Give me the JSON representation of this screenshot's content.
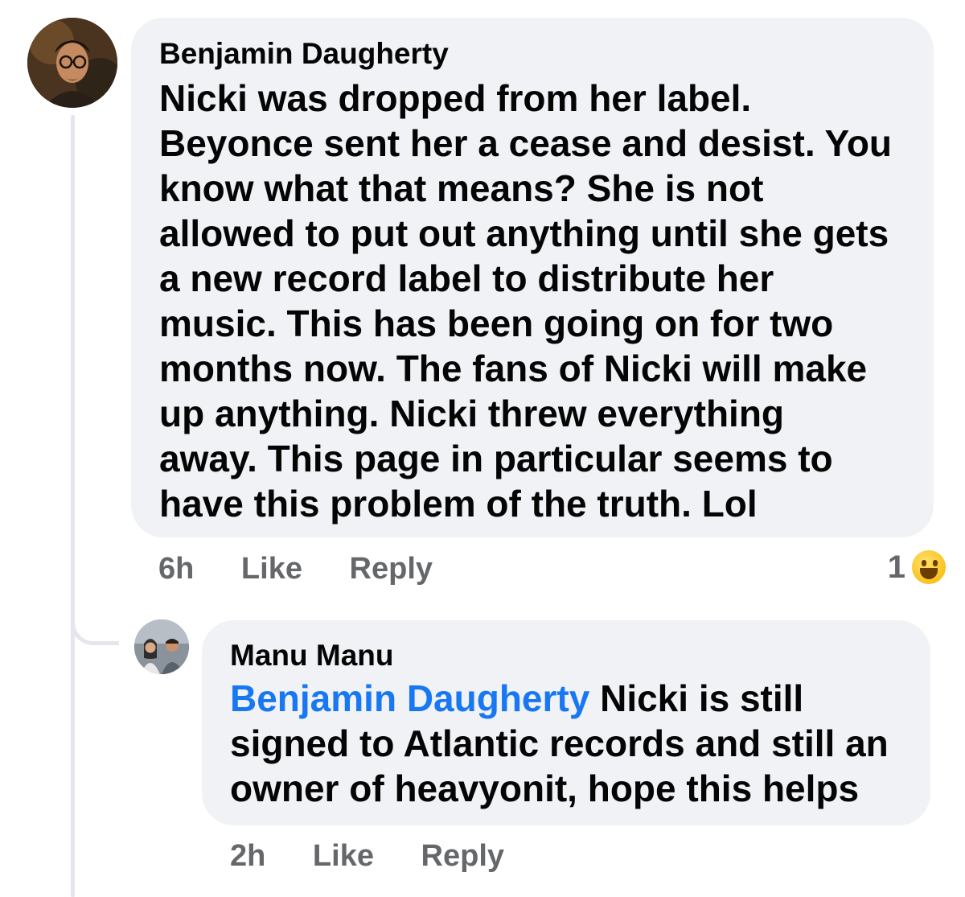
{
  "comment": {
    "author": "Benjamin Daugherty",
    "text": "Nicki was dropped from her label.\nBeyonce sent her a cease and desist. You\nknow what that means? She is not\nallowed to put out anything until she gets\na new record label to distribute her\nmusic. This has been going on for two\nmonths now. The fans of Nicki will make\nup anything. Nicki threw everything\naway. This page in particular seems to\nhave this problem of the truth. Lol",
    "time": "6h",
    "like_label": "Like",
    "reply_label": "Reply",
    "reaction_count": "1",
    "reaction_icon": "laughing-emoji-icon"
  },
  "reply": {
    "author": "Manu Manu",
    "mention": "Benjamin Daugherty",
    "text_line1": " Nicki is still",
    "text_rest": "signed to Atlantic records and still an\nowner of heavyonit, hope this helps",
    "time": "2h",
    "like_label": "Like",
    "reply_label": "Reply"
  },
  "colors": {
    "bubble": "#f0f2f5",
    "mention": "#1877f2",
    "meta": "#65676b",
    "text": "#050505"
  }
}
